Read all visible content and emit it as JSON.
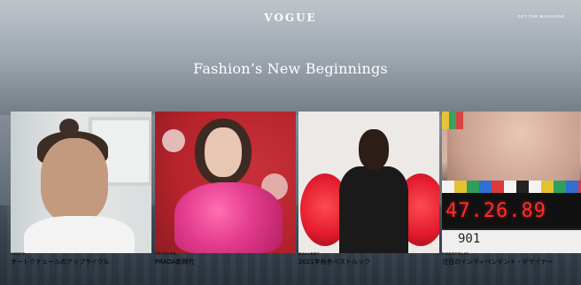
{
  "brand": {
    "logo": "VOGUE"
  },
  "header": {
    "get_magazine": "GET THE MAGAZINE"
  },
  "hero": {
    "title": "Fashion’s New Beginnings"
  },
  "cards": [
    {
      "category": "VIDEO",
      "title": "オートクチュールのアップサイクル"
    },
    {
      "category": "FEATURE",
      "title": "PRADA新時代"
    },
    {
      "category": "GALLERY",
      "title": "2021年秋冬ベストルック"
    },
    {
      "category": "PORTFOLIO",
      "title": "注目のインディペンデント・デザイナー"
    }
  ],
  "clapper": {
    "timecode": "47.26.89",
    "slate_number": "901"
  },
  "colors": {
    "text": "#ffffff",
    "clapper_red": "#ff2d2d"
  }
}
